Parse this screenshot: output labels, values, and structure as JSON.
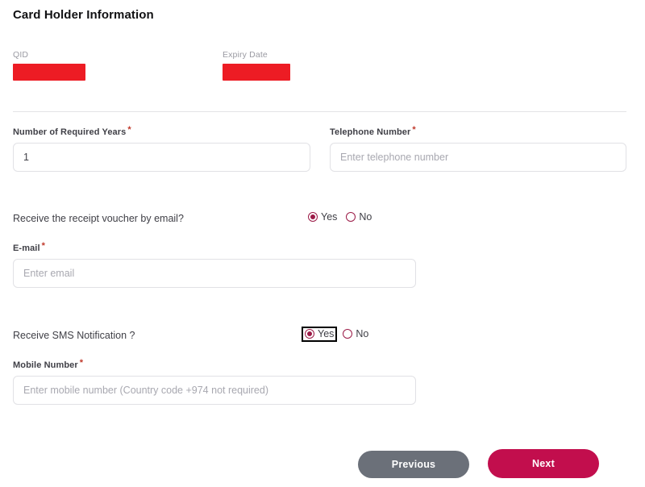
{
  "header": {
    "title": "Card Holder Information"
  },
  "readonly_fields": [
    {
      "label": "QID",
      "value_redacted": true
    },
    {
      "label": "Expiry Date",
      "value_redacted": true
    }
  ],
  "form": {
    "required_marker": "*",
    "years": {
      "label": "Number of Required Years",
      "value": "1",
      "placeholder": ""
    },
    "telephone": {
      "label": "Telephone Number",
      "value": "",
      "placeholder": "Enter telephone number"
    },
    "email": {
      "label": "E-mail",
      "value": "",
      "placeholder": "Enter email"
    },
    "mobile": {
      "label": "Mobile Number",
      "value": "",
      "placeholder": "Enter mobile number (Country code +974 not required)"
    }
  },
  "questions": {
    "voucher_email": {
      "text": "Receive the receipt voucher by email?",
      "yes_label": "Yes",
      "no_label": "No",
      "selected": "Yes",
      "focused": false
    },
    "sms_notification": {
      "text": "Receive SMS Notification ?",
      "yes_label": "Yes",
      "no_label": "No",
      "selected": "Yes",
      "focused": true
    }
  },
  "footer": {
    "previous_label": "Previous",
    "next_label": "Next"
  },
  "colors": {
    "accent": "#C20E4D",
    "radio": "#9B1B47",
    "redaction": "#ED1C24",
    "secondary_button": "#6B7079",
    "required": "#c0392b"
  }
}
